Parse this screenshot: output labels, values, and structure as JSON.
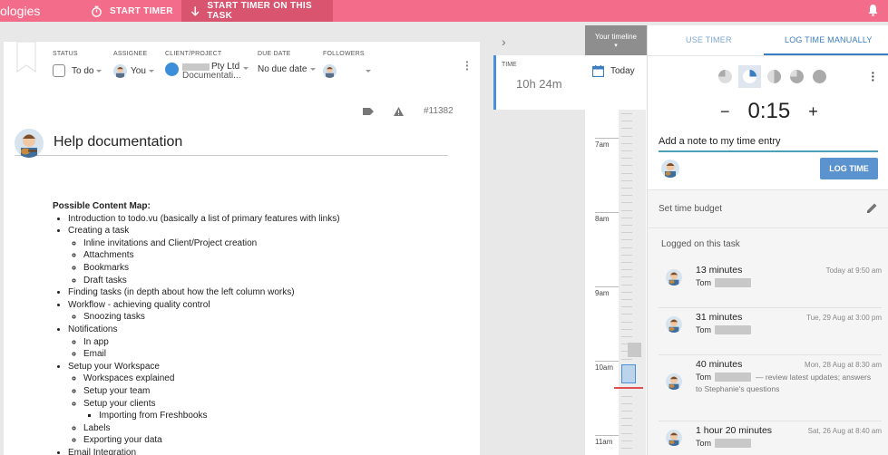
{
  "topbar": {
    "brand": "ologies",
    "start_timer": "START TIMER",
    "start_timer_task": "START TIMER ON THIS TASK"
  },
  "task": {
    "status_label": "STATUS",
    "status_value": "To do",
    "assignee_label": "ASSIGNEE",
    "assignee_value": "You",
    "client_label": "CLIENT/PROJECT",
    "client_value": "Pty Ltd",
    "project_value": "Documentati...",
    "due_label": "DUE DATE",
    "due_value": "No due date",
    "followers_label": "FOLLOWERS",
    "task_id": "#11382",
    "title": "Help documentation",
    "content_heading": "Possible Content Map:",
    "content": {
      "intro": "Introduction to todo.vu (basically a list of primary features with links)",
      "creating": "Creating a task",
      "inline": "Inline invitations and Client/Project creation",
      "attachments": "Attachments",
      "bookmarks": "Bookmarks",
      "drafts": "Draft tasks",
      "finding": "Finding tasks (in depth about how the left column works)",
      "workflow": "Workflow - achieving quality control",
      "snoozing": "Snoozing tasks",
      "notifications": "Notifications",
      "inapp": "In app",
      "email": "Email",
      "setup_ws": "Setup your Workspace",
      "ws_explained": "Workspaces explained",
      "setup_team": "Setup your team",
      "setup_clients": "Setup your clients",
      "importing": "Importing from Freshbooks",
      "labels": "Labels",
      "exporting": "Exporting your data",
      "email_int": "Email Integration"
    }
  },
  "middle": {
    "time_label": "TIME",
    "time_value": "10h 24m",
    "day_label": "Today"
  },
  "timeline": {
    "header": "Your timeline",
    "hours": [
      "7am",
      "8am",
      "9am",
      "10am",
      "11am"
    ]
  },
  "right": {
    "tab_use": "USE TIMER",
    "tab_log": "LOG TIME MANUALLY",
    "time_value": "0:15",
    "minus": "−",
    "plus": "+",
    "note": "Add a note to my time entry",
    "log_button": "LOG TIME",
    "budget": "Set time budget",
    "logged_heading": "Logged on this task",
    "entries": [
      {
        "duration": "13 minutes",
        "when": "Today at 9:50 am",
        "who": "Tom",
        "desc": ""
      },
      {
        "duration": "31 minutes",
        "when": "Tue, 29 Aug at 3:00 pm",
        "who": "Tom",
        "desc": ""
      },
      {
        "duration": "40 minutes",
        "when": "Mon, 28 Aug at 8:30 am",
        "who": "Tom",
        "desc": "— review latest updates; answers to Stephanie's questions"
      },
      {
        "duration": "1 hour 20 minutes",
        "when": "Sat, 26 Aug at 8:40 am",
        "who": "Tom",
        "desc": ""
      }
    ]
  },
  "colors": {
    "topbar": "#f36c8a",
    "accent": "#3b7dc1",
    "button": "#5b93cf"
  }
}
